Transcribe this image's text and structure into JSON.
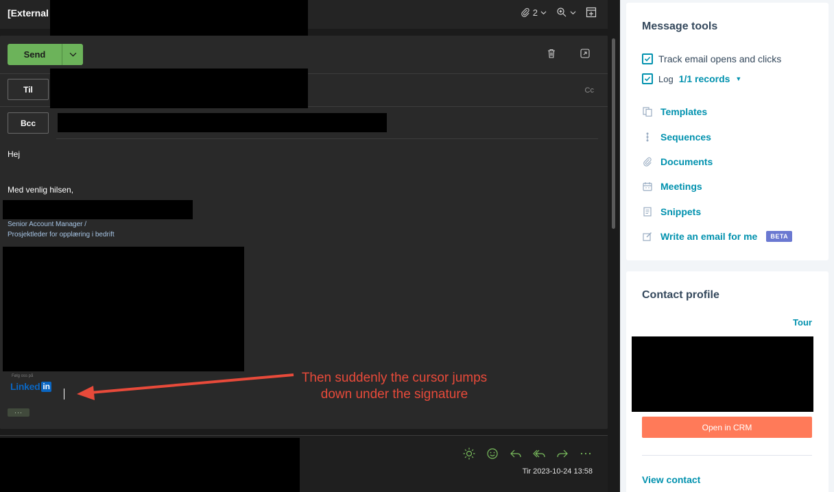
{
  "subject": {
    "text": "[External"
  },
  "subject_tools": {
    "attachment_count": "2"
  },
  "compose": {
    "send_label": "Send",
    "to_label": "Til",
    "bcc_label": "Bcc",
    "cc_label": "Cc",
    "greeting": "Hej",
    "closing": "Med venlig hilsen,",
    "signature_title_1": "Senior Account Manager /",
    "signature_title_2": "Prosjektleder for opplæring i bedrift",
    "follow_text": "Følg oss på",
    "linkedin_word": "Linked",
    "linkedin_in": "in",
    "expand_label": "···"
  },
  "annotation": {
    "line1": "Then suddenly the cursor jumps",
    "line2": "down under the signature",
    "color": "#e84a3a"
  },
  "thread": {
    "date": "Tir 2023-10-24 13:58"
  },
  "sidebar": {
    "message_tools_title": "Message tools",
    "track_label": "Track email opens and clicks",
    "log_label": "Log",
    "log_records": "1/1 records",
    "tools": [
      {
        "label": "Templates",
        "icon": "templates-icon"
      },
      {
        "label": "Sequences",
        "icon": "sequences-icon"
      },
      {
        "label": "Documents",
        "icon": "paperclip-icon"
      },
      {
        "label": "Meetings",
        "icon": "calendar-icon"
      },
      {
        "label": "Snippets",
        "icon": "snippets-icon"
      },
      {
        "label": "Write an email for me",
        "icon": "edit-icon"
      }
    ],
    "beta_label": "BETA",
    "contact_profile_title": "Contact profile",
    "tour_label": "Tour",
    "open_crm_label": "Open in CRM",
    "view_contact_label": "View contact"
  },
  "colors": {
    "send_green": "#6cb35a",
    "hubspot_teal": "#0091ae",
    "crm_orange": "#ff7a59",
    "beta_purple": "#6a78d1"
  }
}
